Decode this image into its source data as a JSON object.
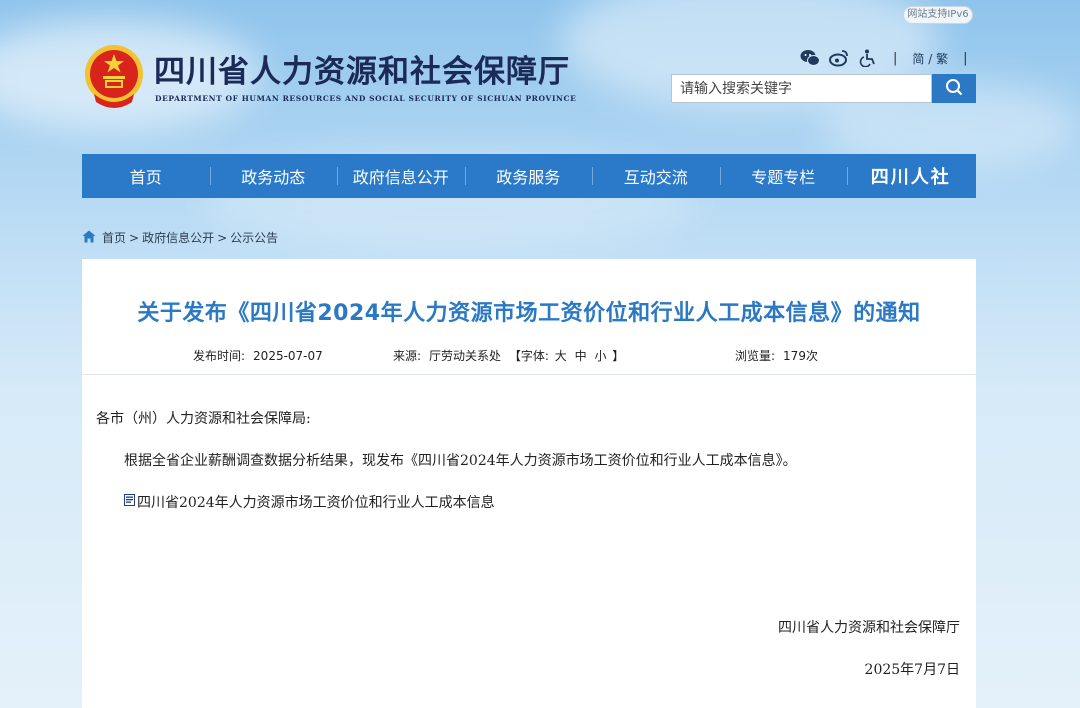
{
  "header": {
    "ipv6_badge": "网站支持IPv6",
    "site_title": "四川省人力资源和社会保障厅",
    "site_subtitle": "DEPARTMENT OF HUMAN RESOURCES AND SOCIAL SECURITY OF SICHUAN PROVINCE",
    "language_toggle": "简 / 繁",
    "tools_separator": "|",
    "search": {
      "placeholder": "请输入搜索关键字"
    }
  },
  "nav": {
    "items": [
      "首页",
      "政务动态",
      "政府信息公开",
      "政务服务",
      "互动交流",
      "专题专栏"
    ],
    "brand_label": "四川人社"
  },
  "breadcrumb": {
    "items": [
      "首页",
      "政府信息公开",
      "公示公告"
    ],
    "separator": ">"
  },
  "article": {
    "title": "关于发布《四川省2024年人力资源市场工资价位和行业人工成本信息》的通知",
    "meta": {
      "publish_label": "发布时间:",
      "publish_date": "2025-07-07",
      "source_label": "来源:",
      "source": "厅劳动关系处",
      "font_label_open": "【字体:",
      "font_sizes": [
        "大",
        "中",
        "小"
      ],
      "font_label_close": "】",
      "views_label": "浏览量:",
      "views": "179次"
    },
    "salutation": "各市（州）人力资源和社会保障局:",
    "paragraph": "根据全省企业薪酬调查数据分析结果，现发布《四川省2024年人力资源市场工资价位和行业人工成本信息》。",
    "attachment": "四川省2024年人力资源市场工资价位和行业人工成本信息",
    "signature": "四川省人力资源和社会保障厅",
    "date": "2025年7月7日"
  },
  "colors": {
    "nav": "#2b7ac9",
    "title": "#2b78c4",
    "search_button": "#2b78c4"
  }
}
